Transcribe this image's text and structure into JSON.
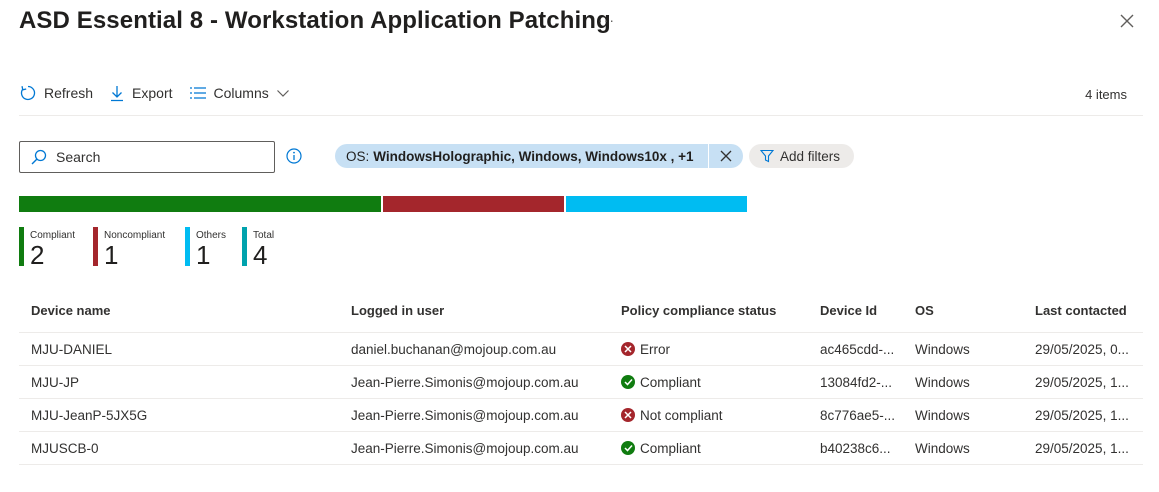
{
  "header": {
    "title": "ASD Essential 8 - Workstation Application Patching",
    "more_label": "···"
  },
  "toolbar": {
    "refresh_label": "Refresh",
    "export_label": "Export",
    "columns_label": "Columns",
    "items_count": "4 items"
  },
  "search": {
    "placeholder": "Search"
  },
  "filter": {
    "key": "OS:",
    "value": "WindowsHolographic, Windows, Windows10x , +1",
    "add_filters_label": "Add filters"
  },
  "summary": {
    "compliant": 2,
    "noncompliant": 1,
    "others": 1,
    "legend": [
      {
        "label": "Compliant",
        "value": "2",
        "color": "#107c10"
      },
      {
        "label": "Noncompliant",
        "value": "1",
        "color": "#a4262c"
      },
      {
        "label": "Others",
        "value": "1",
        "color": "#00bcf2"
      },
      {
        "label": "Total",
        "value": "4",
        "color": "#00a2ad"
      }
    ]
  },
  "table": {
    "columns": [
      "Device name",
      "Logged in user",
      "Policy compliance status",
      "Device Id",
      "OS",
      "Last contacted"
    ],
    "rows": [
      {
        "device": "MJU-DANIEL",
        "user": "daniel.buchanan@mojoup.com.au",
        "status": "Error",
        "status_type": "error",
        "device_id": "ac465cdd-...",
        "os": "Windows",
        "last": "29/05/2025, 0..."
      },
      {
        "device": "MJU-JP",
        "user": "Jean-Pierre.Simonis@mojoup.com.au",
        "status": "Compliant",
        "status_type": "ok",
        "device_id": "13084fd2-...",
        "os": "Windows",
        "last": "29/05/2025, 1..."
      },
      {
        "device": "MJU-JeanP-5JX5G",
        "user": "Jean-Pierre.Simonis@mojoup.com.au",
        "status": "Not compliant",
        "status_type": "error",
        "device_id": "8c776ae5-...",
        "os": "Windows",
        "last": "29/05/2025, 1..."
      },
      {
        "device": "MJUSCB-0",
        "user": "Jean-Pierre.Simonis@mojoup.com.au",
        "status": "Compliant",
        "status_type": "ok",
        "device_id": "b40238c6...",
        "os": "Windows",
        "last": "29/05/2025, 1..."
      }
    ]
  },
  "colors": {
    "accent": "#0078d4",
    "error": "#a4262c",
    "ok": "#107c10",
    "pill": "#c7e0f4"
  }
}
